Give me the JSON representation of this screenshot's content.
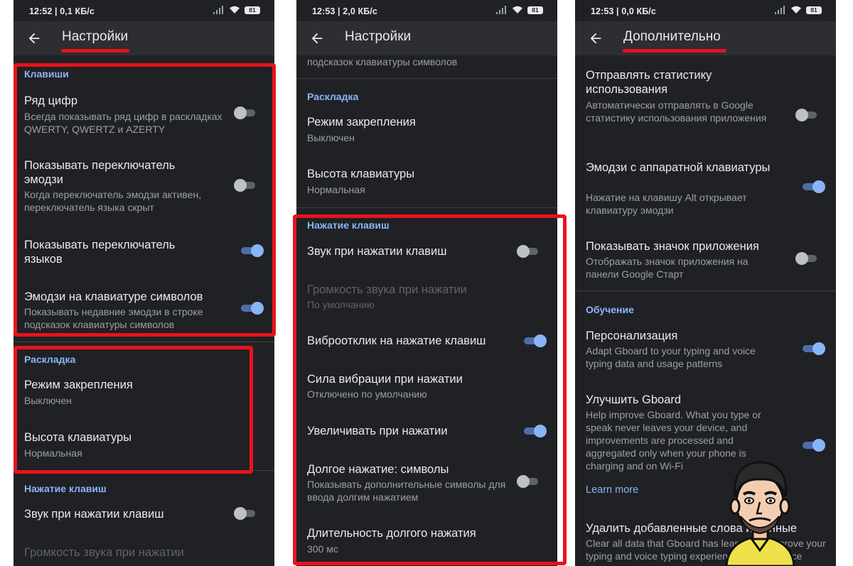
{
  "colors": {
    "background": "#202124",
    "accent": "#8ab4f8",
    "highlight": "#e8121e"
  },
  "screens": [
    {
      "status": {
        "time": "12:52 | 0,1 КБ/с",
        "battery": "81"
      },
      "title": "Настройки",
      "sections": [
        {
          "header": "Клавиши",
          "items": [
            {
              "title": "Ряд цифр",
              "subtitle": "Всегда показывать ряд цифр в раскладках QWERTY, QWERTZ и AZERTY",
              "toggle": false
            },
            {
              "title": "Показывать переключатель эмодзи",
              "subtitle": "Когда переключатель эмодзи активен, переключатель языка скрыт",
              "toggle": false
            },
            {
              "title": "Показывать переключатель языков",
              "toggle": true
            },
            {
              "title": "Эмодзи на клавиатуре символов",
              "subtitle": "Показывать недавние эмодзи в строке подсказок клавиатуры символов",
              "toggle": true
            }
          ]
        },
        {
          "header": "Раскладка",
          "items": [
            {
              "title": "Режим закрепления",
              "subtitle": "Выключен"
            },
            {
              "title": "Высота клавиатуры",
              "subtitle": "Нормальная"
            }
          ]
        },
        {
          "header": "Нажатие клавиш",
          "items": [
            {
              "title": "Звук при нажатии клавиш",
              "toggle": false
            },
            {
              "title": "Громкость звука при нажатии",
              "disabled": true
            }
          ]
        }
      ]
    },
    {
      "status": {
        "time": "12:53 | 2,0 КБ/с",
        "battery": "81"
      },
      "title": "Настройки",
      "top_fragment": "подсказок клавиатуры символов",
      "sections": [
        {
          "header": "Раскладка",
          "items": [
            {
              "title": "Режим закрепления",
              "subtitle": "Выключен"
            },
            {
              "title": "Высота клавиатуры",
              "subtitle": "Нормальная"
            }
          ]
        },
        {
          "header": "Нажатие клавиш",
          "items": [
            {
              "title": "Звук при нажатии клавиш",
              "toggle": false
            },
            {
              "title": "Громкость звука при нажатии",
              "subtitle": "По умолчанию",
              "disabled": true
            },
            {
              "title": "Виброотклик на нажатие клавиш",
              "toggle": true
            },
            {
              "title": "Сила вибрации при нажатии",
              "subtitle": "Отключено по умолчанию"
            },
            {
              "title": "Увеличивать при нажатии",
              "toggle": true
            },
            {
              "title": "Долгое нажатие: символы",
              "subtitle": "Показывать дополнительные символы для ввода долгим нажатием",
              "toggle": false
            },
            {
              "title": "Длительность долгого нажатия",
              "subtitle": "300 мс"
            }
          ]
        }
      ]
    },
    {
      "status": {
        "time": "12:53 | 0,0 КБ/с",
        "battery": "81"
      },
      "title": "Дополнительно",
      "sections": [
        {
          "header": "",
          "items": [
            {
              "title": "Отправлять статистику использования",
              "subtitle": "Автоматически отправлять в Google статистику использования приложения",
              "toggle": false
            },
            {
              "title": "Эмодзи с аппаратной клавиатуры",
              "subtitle": "Нажатие на клавишу Alt открывает клавиатуру эмодзи",
              "toggle": true
            },
            {
              "title": "Показывать значок приложения",
              "subtitle": "Отображать значок приложения на панели Google Старт",
              "toggle": false
            }
          ]
        },
        {
          "header": "Обучение",
          "items": [
            {
              "title": "Персонализация",
              "subtitle": "Adapt Gboard to your typing and voice typing data and usage patterns",
              "toggle": true
            },
            {
              "title": "Улучшить Gboard",
              "subtitle": "Help improve Gboard. What you type or speak never leaves your device, and improvements are processed and aggregated only when your phone is charging and on Wi-Fi",
              "toggle": true,
              "link": "Learn more"
            },
            {
              "title": "Удалить добавленные слова и данные",
              "subtitle": "Clear all data that Gboard has learned to improve your typing and voice typing experience on this device"
            }
          ]
        }
      ]
    }
  ]
}
